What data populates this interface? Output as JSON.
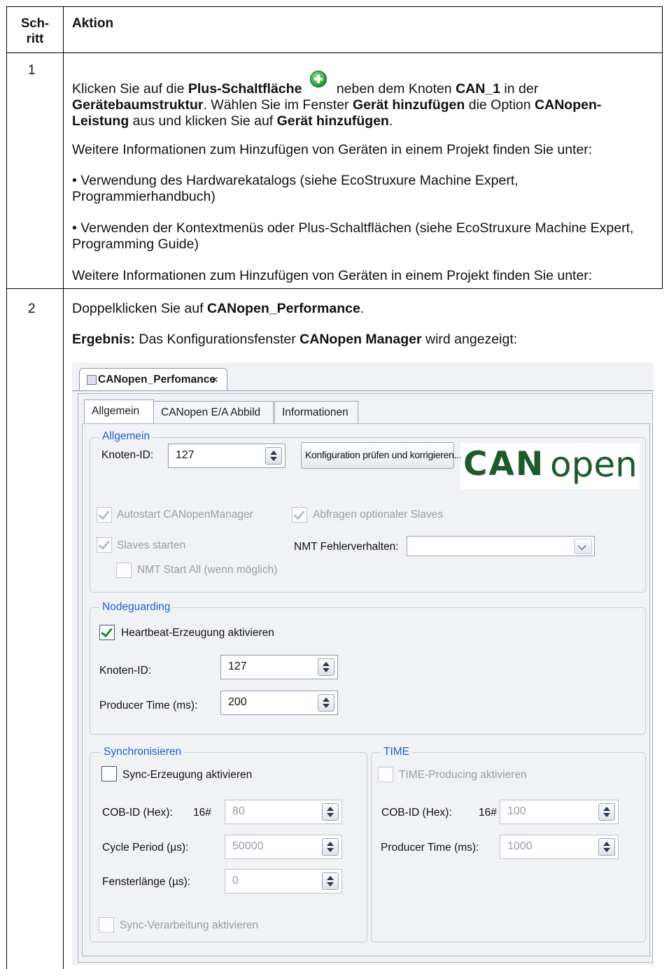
{
  "table": {
    "header": {
      "step": "Sch-\nritt",
      "action": "Aktion"
    },
    "row1": {
      "step": "1",
      "p1": {
        "a": "Klicken Sie auf die ",
        "b": "Plus-Schaltfläche",
        "c": " neben dem Knoten ",
        "d": "CAN_1",
        "e": " in der ",
        "f": "Gerätebaumstruktur",
        "g": ". Wählen Sie im Fenster ",
        "h": "Gerät hinzufügen",
        "i": " die Option ",
        "j": "CANopen-Leistung",
        "k": " aus und klicken Sie auf ",
        "l": "Gerät hinzufügen",
        "m": "."
      },
      "p2": "Weitere Informationen zum Hinzufügen von Geräten in einem Projekt finden Sie unter:",
      "p3": "• Verwendung des Hardwarekatalogs (siehe EcoStruxure Machine Expert, Programmierhandbuch)",
      "p4": "• Verwenden der Kontextmenüs oder Plus-Schaltflächen (siehe EcoStruxure Machine Expert, Programming Guide)",
      "p5": "Weitere Informationen zum Hinzufügen von Geräten in einem Projekt finden Sie unter:"
    },
    "row2": {
      "step": "2",
      "p1": {
        "a": "Doppelklicken Sie auf ",
        "b": "CANopen_Performance",
        "c": "."
      },
      "p2": {
        "a": "Ergebnis:",
        "b": " Das Konfigurationsfenster ",
        "c": "CANopen Manager",
        "d": " wird angezeigt:"
      }
    }
  },
  "screenshot": {
    "doc_tab": "CANopen_Perfomance",
    "close_glyph": "×",
    "tabs": [
      "Allgemein",
      "CANopen E/A Abbild",
      "Informationen"
    ],
    "allgemein": {
      "title": "Allgemein",
      "node_id_label": "Knoten-ID:",
      "node_id_value": "127",
      "check_button": "Konfiguration prüfen und korrigieren...",
      "logo_can": "CAN",
      "logo_open": "open",
      "autostart": "Autostart CANopenManager",
      "optional_slaves": "Abfragen optionaler Slaves",
      "start_slaves": "Slaves starten",
      "nmt_error_label": "NMT Fehlerverhalten:",
      "nmt_start_all": "NMT Start All (wenn möglich)"
    },
    "nodeguarding": {
      "title": "Nodeguarding",
      "heartbeat": "Heartbeat-Erzeugung aktivieren",
      "node_id_label": "Knoten-ID:",
      "node_id_value": "127",
      "producer_label": "Producer Time (ms):",
      "producer_value": "200"
    },
    "sync": {
      "title": "Synchronisieren",
      "enable": "Sync-Erzeugung aktivieren",
      "cob_label": "COB-ID (Hex):",
      "hex_prefix": "16#",
      "cob_value": "80",
      "cycle_label": "Cycle Period (µs):",
      "cycle_value": "50000",
      "window_label": "Fensterlänge (µs):",
      "window_value": "0",
      "process": "Sync-Verarbeitung aktivieren"
    },
    "time": {
      "title": "TIME",
      "enable": "TIME-Producing aktivieren",
      "cob_label": "COB-ID (Hex):",
      "hex_prefix": "16#",
      "cob_value": "100",
      "producer_label": "Producer Time (ms):",
      "producer_value": "1000"
    }
  }
}
